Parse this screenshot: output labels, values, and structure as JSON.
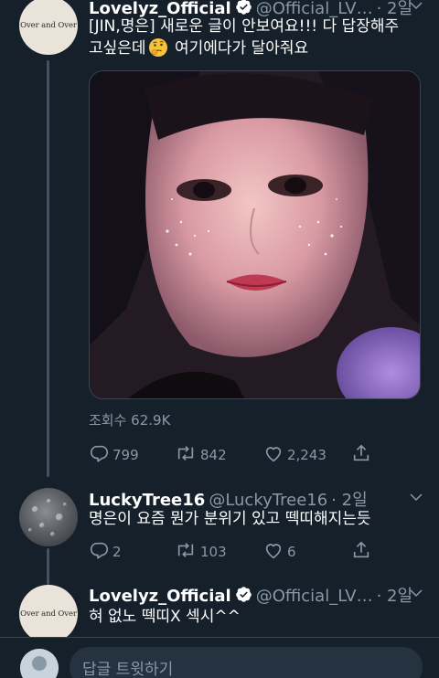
{
  "tweets": [
    {
      "name": "Lovelyz_Official",
      "handle": "@Official_LV…",
      "time": "· 2일",
      "avatar_text": "Over and Over",
      "text_line1": "[JIN,명은] 새로운 글이 안보여요!!! 다 답장해주",
      "text_line2_a": "고싶은데",
      "text_line2_b": " 여기에다가 달아줘요",
      "views": "조회수 62.9K",
      "replies": "799",
      "retweets": "842",
      "likes": "2,243"
    },
    {
      "name": "LuckyTree16",
      "handle": "@LuckyTree16",
      "time": "· 2일",
      "text": "명은이 요즘 뭔가 분위기 있고 떽띠해지는듯",
      "replies": "2",
      "retweets": "103",
      "likes": "6"
    },
    {
      "name": "Lovelyz_Official",
      "handle": "@Official_LV…",
      "time": "· 2일",
      "avatar_text": "Over and Over",
      "text": "혀 없노 떽띠X 섹시^^"
    }
  ],
  "reply_bar": {
    "placeholder": "답글 트윗하기"
  },
  "colors": {
    "background": "#15202b",
    "secondary_text": "#8899a6",
    "verified": "#ffffff",
    "accent": "#1da1f2"
  },
  "icons": [
    "verified-icon",
    "chevron-down-icon",
    "reply-icon",
    "retweet-icon",
    "like-icon",
    "share-icon",
    "thinking-face-emoji"
  ]
}
